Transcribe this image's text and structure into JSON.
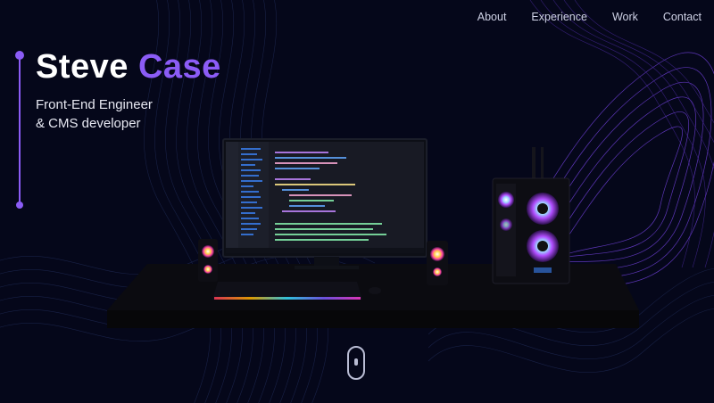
{
  "nav": {
    "items": [
      "About",
      "Experience",
      "Work",
      "Contact"
    ]
  },
  "hero": {
    "first_name": "Steve",
    "last_name": "Case",
    "subtitle_line1": "Front-End Engineer",
    "subtitle_line2": "& CMS developer"
  },
  "colors": {
    "background": "#05071a",
    "accent": "#8b5cf6",
    "text": "#ffffff"
  }
}
